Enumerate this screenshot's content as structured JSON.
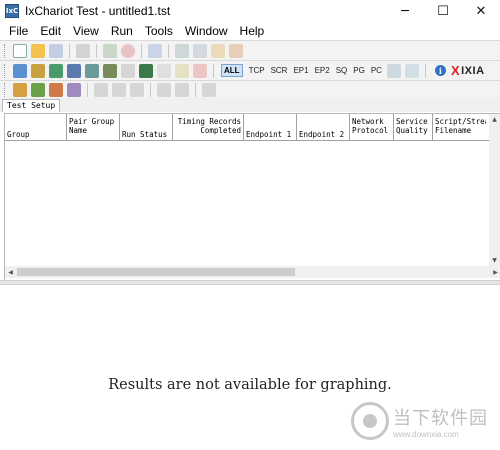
{
  "window": {
    "app_icon_text": "IxC",
    "title": "IxChariot Test - untitled1.tst",
    "controls": {
      "minimize": "─",
      "maximize": "☐",
      "close": "✕"
    }
  },
  "menu": [
    {
      "id": "file",
      "label": "File"
    },
    {
      "id": "edit",
      "label": "Edit"
    },
    {
      "id": "view",
      "label": "View"
    },
    {
      "id": "run",
      "label": "Run"
    },
    {
      "id": "tools",
      "label": "Tools"
    },
    {
      "id": "window",
      "label": "Window"
    },
    {
      "id": "help",
      "label": "Help"
    }
  ],
  "toolbar": {
    "filter_all": "ALL",
    "filter_tcp": "TCP",
    "filter_scr": "SCR",
    "filter_ep1": "EP1",
    "filter_ep2": "EP2",
    "filter_sq": "SQ",
    "filter_pg": "PG",
    "filter_pc": "PC",
    "logo_text": "IXIA",
    "logo_x": "X",
    "info_glyph": "i",
    "accent_color": "#d22222"
  },
  "tabs": [
    {
      "label": "Test Setup",
      "active": true
    }
  ],
  "grid": {
    "columns": [
      {
        "line1": "Group",
        "line2": ""
      },
      {
        "line1": "Pair Group",
        "line2": "Name"
      },
      {
        "line1": "Run Status",
        "line2": ""
      },
      {
        "line1": "Timing Records",
        "line2": "Completed"
      },
      {
        "line1": "Endpoint 1",
        "line2": ""
      },
      {
        "line1": "Endpoint 2",
        "line2": ""
      },
      {
        "line1": "Network",
        "line2": "Protocol"
      },
      {
        "line1": "Service",
        "line2": "Quality"
      },
      {
        "line1": "Script/Strea",
        "line2": "Filename"
      }
    ],
    "rows": []
  },
  "results": {
    "message": "Results are not available for graphing."
  },
  "watermark": {
    "brand": "当下软件园",
    "url": "www.downxia.com"
  }
}
